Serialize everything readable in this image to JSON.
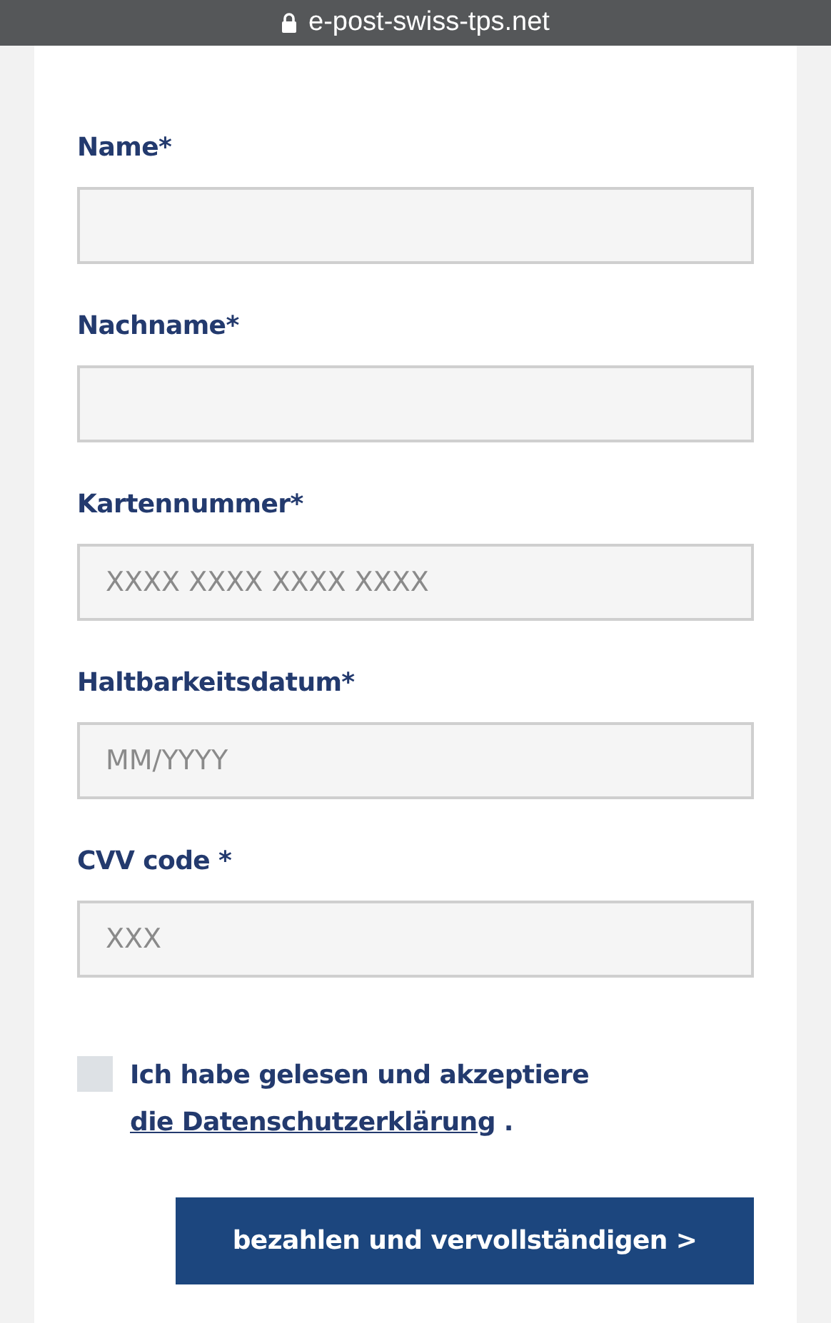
{
  "browser_bar": {
    "url": "e-post-swiss-tps.net"
  },
  "fields": [
    {
      "label": "Name*"
    },
    {
      "label": "Nachname*"
    },
    {
      "label": "Kartennummer*",
      "placeholder": "XXXX XXXX XXXX XXXX"
    },
    {
      "label": "Haltbarkeitsdatum*",
      "placeholder": "MM/YYYY"
    },
    {
      "label": "CVV code *",
      "placeholder": "XXX"
    }
  ],
  "consent": {
    "checked": false,
    "text": "Ich habe gelesen und akzeptiere",
    "link": "die Datenschutzerklärung",
    "after": "."
  },
  "submit_button": "bezahlen und vervollständigen >"
}
